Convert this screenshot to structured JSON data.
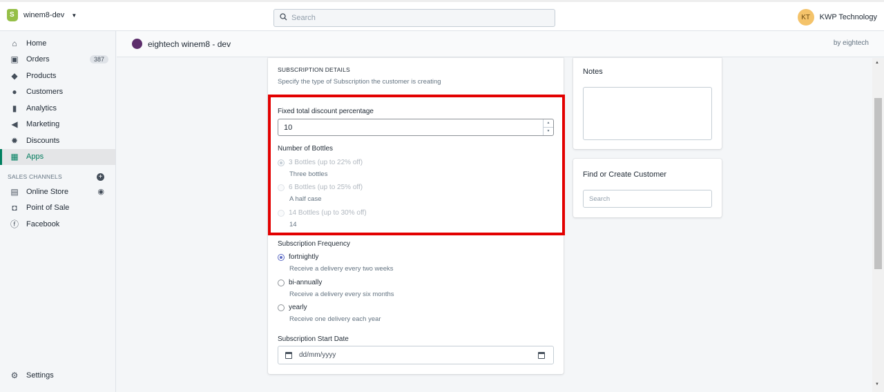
{
  "topbar": {
    "store_name": "winem8-dev",
    "search_placeholder": "Search",
    "user_initials": "KT",
    "user_name": "KWP Technology"
  },
  "sidebar": {
    "items": [
      {
        "label": "Home",
        "icon": "home-icon"
      },
      {
        "label": "Orders",
        "icon": "orders-icon",
        "badge": "387"
      },
      {
        "label": "Products",
        "icon": "tag-icon"
      },
      {
        "label": "Customers",
        "icon": "person-icon"
      },
      {
        "label": "Analytics",
        "icon": "bar-chart-icon"
      },
      {
        "label": "Marketing",
        "icon": "megaphone-icon"
      },
      {
        "label": "Discounts",
        "icon": "discount-icon"
      },
      {
        "label": "Apps",
        "icon": "apps-icon",
        "active": true
      }
    ],
    "sales_channels_label": "SALES CHANNELS",
    "channels": [
      {
        "label": "Online Store",
        "icon": "store-icon"
      },
      {
        "label": "Point of Sale",
        "icon": "bag-icon"
      },
      {
        "label": "Facebook",
        "icon": "facebook-icon"
      }
    ],
    "settings_label": "Settings"
  },
  "appbar": {
    "title": "eightech winem8 - dev",
    "by": "by eightech"
  },
  "subscription": {
    "heading": "SUBSCRIPTION DETAILS",
    "subtext": "Specify the type of Subscription the customer is creating",
    "discount_label": "Fixed total discount percentage",
    "discount_value": "10",
    "bottles_label": "Number of Bottles",
    "bottles": [
      {
        "label": "3 Bottles (up to 22% off)",
        "help": "Three bottles",
        "checked": true
      },
      {
        "label": "6 Bottles (up to 25% off)",
        "help": "A half case",
        "checked": false
      },
      {
        "label": "14 Bottles (up to 30% off)",
        "help": "14",
        "checked": false
      }
    ],
    "frequency_label": "Subscription Frequency",
    "frequencies": [
      {
        "label": "fortnightly",
        "help": "Receive a delivery every two weeks",
        "checked": true
      },
      {
        "label": "bi-annually",
        "help": "Receive a delivery every six months",
        "checked": false
      },
      {
        "label": "yearly",
        "help": "Receive one delivery each year",
        "checked": false
      }
    ],
    "start_date_label": "Subscription Start Date",
    "start_date_placeholder": "dd/mm/yyyy"
  },
  "notes": {
    "title": "Notes"
  },
  "customer": {
    "title": "Find or Create Customer",
    "search_placeholder": "Search"
  },
  "colors": {
    "accent": "#008060",
    "highlight": "#e30000",
    "radio": "#5c6ac4"
  }
}
